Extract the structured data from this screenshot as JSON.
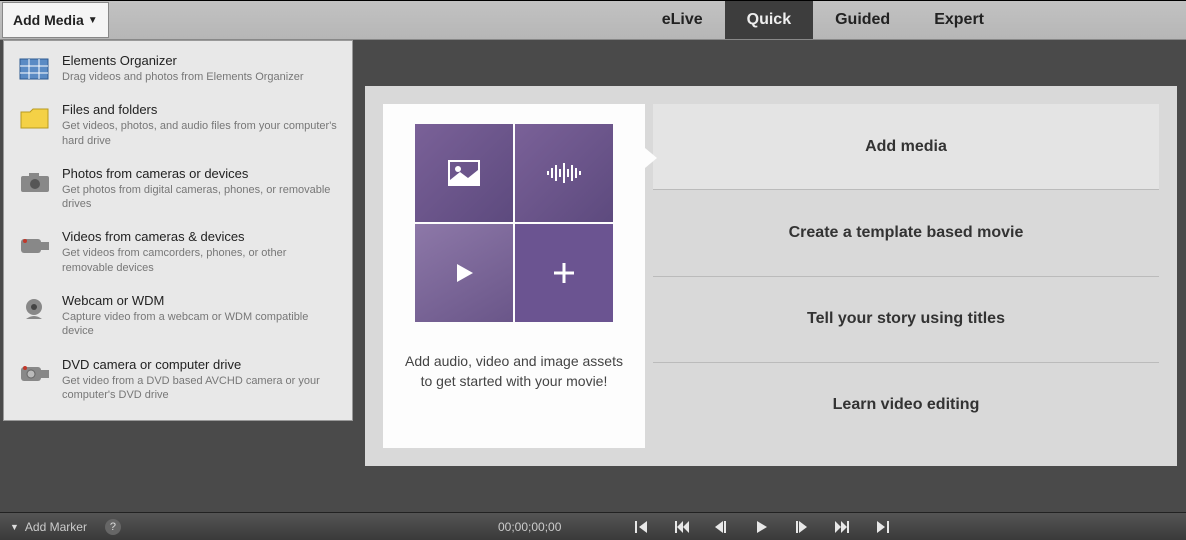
{
  "toolbar": {
    "add_media_label": "Add Media",
    "tabs": [
      "eLive",
      "Quick",
      "Guided",
      "Expert"
    ],
    "active_tab": "Quick"
  },
  "dropdown": {
    "items": [
      {
        "title": "Elements Organizer",
        "desc": "Drag videos and photos from Elements Organizer",
        "icon": "organizer"
      },
      {
        "title": "Files and folders",
        "desc": "Get videos, photos, and audio files from your computer's hard drive",
        "icon": "folder"
      },
      {
        "title": "Photos from cameras or devices",
        "desc": "Get photos from digital cameras, phones, or removable drives",
        "icon": "camera"
      },
      {
        "title": "Videos from cameras & devices",
        "desc": "Get videos from camcorders, phones, or other removable devices",
        "icon": "camcorder"
      },
      {
        "title": "Webcam or WDM",
        "desc": "Capture video from a webcam or WDM compatible device",
        "icon": "webcam"
      },
      {
        "title": "DVD camera or computer drive",
        "desc": "Get video from a DVD based AVCHD camera or your computer's DVD drive",
        "icon": "dvd"
      }
    ]
  },
  "card": {
    "caption_line1": "Add audio, video and image assets",
    "caption_line2": "to get started with your movie!"
  },
  "options": [
    "Add media",
    "Create a template based movie",
    "Tell your story using titles",
    "Learn video editing"
  ],
  "bottombar": {
    "add_marker_label": "Add Marker",
    "timecode": "00;00;00;00"
  }
}
